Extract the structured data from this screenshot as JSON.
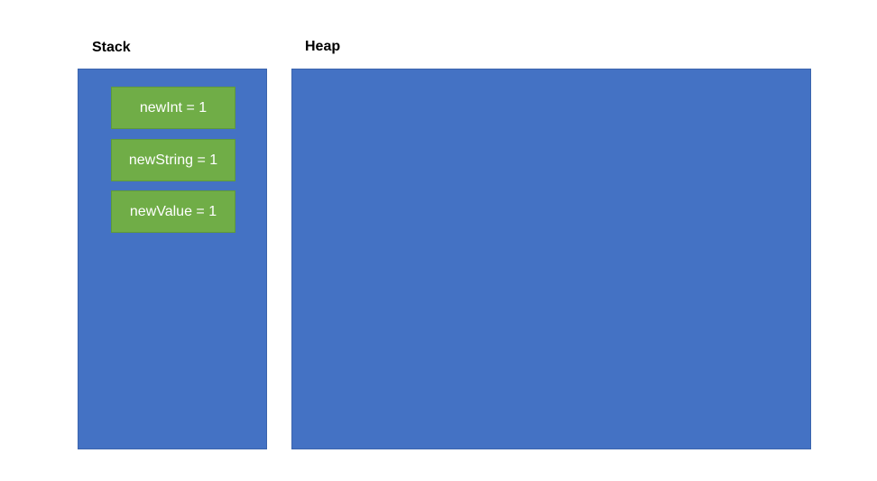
{
  "stack": {
    "label": "Stack",
    "variables": [
      {
        "text": "newInt = 1"
      },
      {
        "text": "newString = 1"
      },
      {
        "text": "newValue = 1"
      }
    ]
  },
  "heap": {
    "label": "Heap"
  },
  "colors": {
    "region_fill": "#4472c4",
    "variable_fill": "#70ad47",
    "variable_text": "#ffffff"
  }
}
